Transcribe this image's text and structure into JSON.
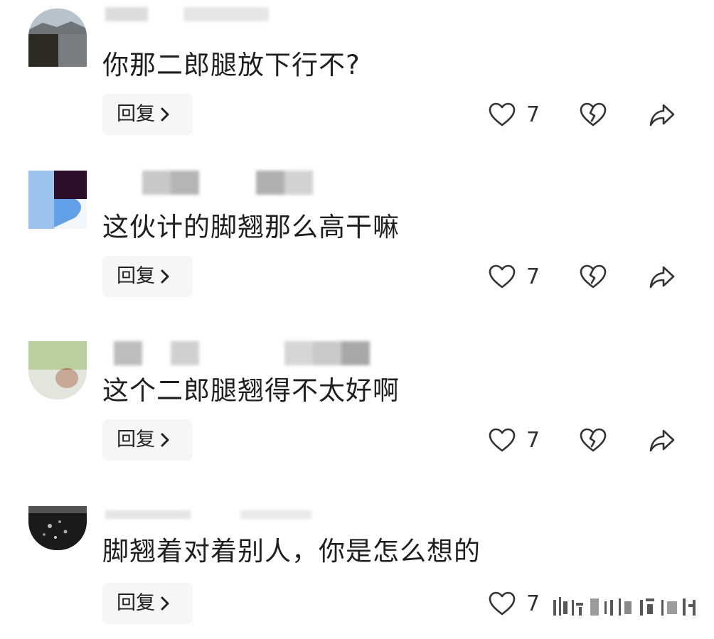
{
  "comments": [
    {
      "text": "你那二郎腿放下行不?",
      "reply_label": "回复",
      "like_count": "7"
    },
    {
      "text": "这伙计的脚翘那么高干嘛",
      "reply_label": "回复",
      "like_count": "7"
    },
    {
      "text": "这个二郎腿翘得不太好啊",
      "reply_label": "回复",
      "like_count": "7"
    },
    {
      "text": "脚翘着对着别人，你是怎么想的",
      "reply_label": "回复",
      "like_count": "7"
    }
  ],
  "icons": {
    "like": "heart-outline-icon",
    "dislike": "broken-heart-icon",
    "share": "share-arrow-icon",
    "reply_chevron": "chevron-right-icon"
  },
  "colors": {
    "text": "#1f1f1f",
    "reply_bg": "#f6f6f6",
    "icon_stroke": "#333333"
  }
}
